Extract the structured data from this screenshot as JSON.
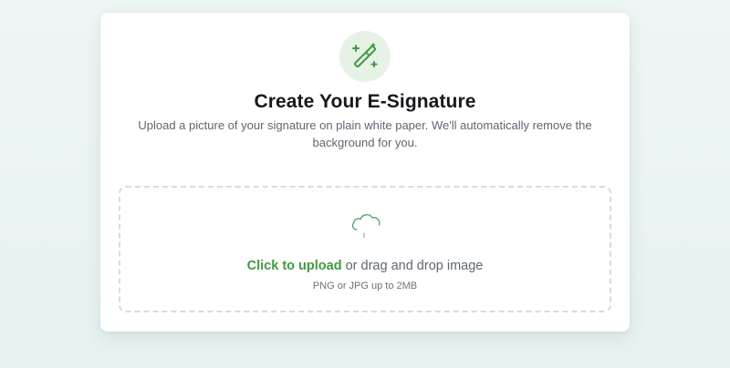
{
  "header": {
    "title": "Create Your E-Signature",
    "subtitle": "Upload a picture of your signature on plain white paper. We'll automatically remove the background for you.",
    "icon": "magic-wand-icon"
  },
  "upload": {
    "link_label": "Click to upload",
    "rest_label": " or drag and drop image",
    "hint": "PNG or JPG up to 2MB",
    "icon": "cloud-upload-icon"
  },
  "colors": {
    "accent": "#3f9a3f",
    "icon_bg": "#e6f2e6",
    "background": "#ebf3f3"
  }
}
